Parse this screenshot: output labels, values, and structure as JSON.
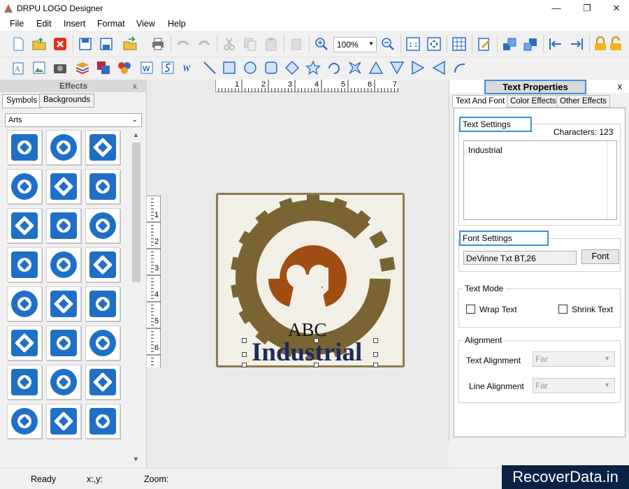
{
  "window": {
    "title": "DRPU LOGO Designer",
    "controls": [
      "—",
      "❐",
      "✕"
    ]
  },
  "menu": [
    "File",
    "Edit",
    "Insert",
    "Format",
    "View",
    "Help"
  ],
  "toolbar": {
    "zoom_value": "100%"
  },
  "effects_panel": {
    "title": "Effects",
    "close": "x",
    "tabs": [
      "Symbols",
      "Backgrounds"
    ],
    "category": "Arts"
  },
  "canvas": {
    "top_ruler": [
      "1",
      "2",
      "3",
      "4",
      "5",
      "6",
      "7"
    ],
    "left_ruler": [
      "1",
      "2",
      "3",
      "4",
      "5",
      "6"
    ],
    "logo_text_line1": "ABC",
    "logo_text_line2": "Industrial",
    "colors": {
      "gear": "#7a6433",
      "emblem": "#a04e14",
      "text": "#1e2a5c"
    }
  },
  "text_properties": {
    "title": "Text Properties",
    "close": "x",
    "tabs": [
      "Text And Font",
      "Color Effects",
      "Other Effects"
    ],
    "text_settings_label": "Text Settings",
    "characters_label": "Characters: 123",
    "text_value": "Industrial",
    "font_settings_label": "Font Settings",
    "font_value": "DeVinne Txt BT,26",
    "font_button": "Font",
    "text_mode_label": "Text Mode",
    "wrap_text": "Wrap Text",
    "shrink_text": "Shrink Text",
    "alignment_label": "Alignment",
    "text_alignment_label": "Text Alignment",
    "text_alignment_value": "Far",
    "line_alignment_label": "Line Alignment",
    "line_alignment_value": "Far"
  },
  "status": {
    "ready": "Ready",
    "coords": "x:,y:",
    "zoom": "Zoom:"
  },
  "watermark": "RecoverData.in"
}
